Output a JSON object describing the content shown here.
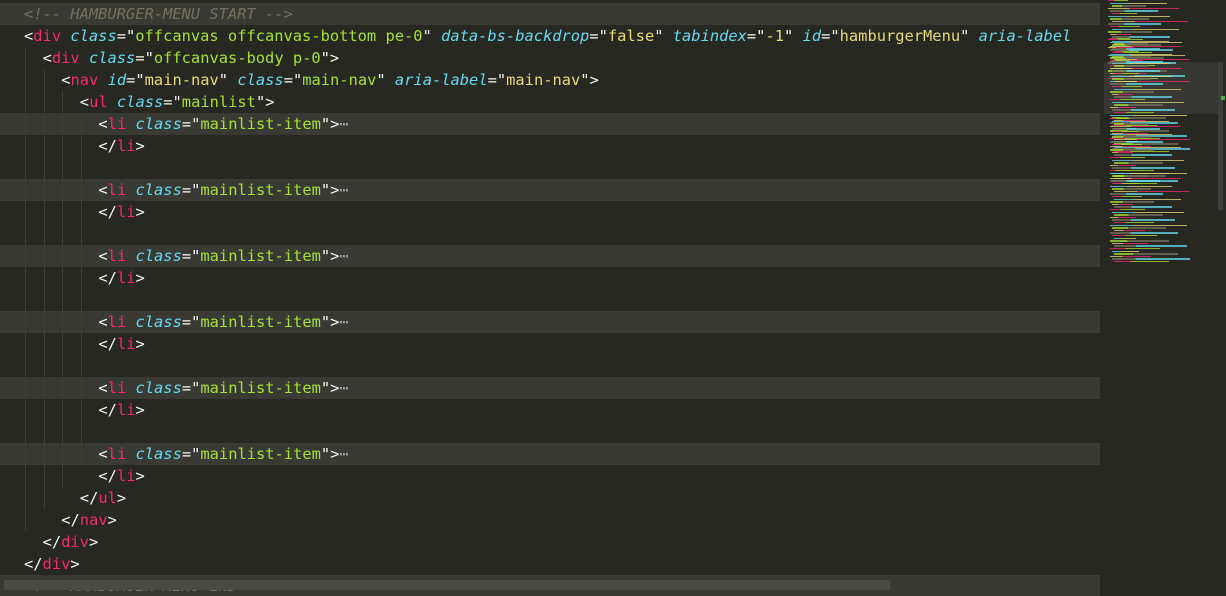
{
  "editor": {
    "lines": [
      {
        "indent": 0,
        "highlight": true,
        "tokens": [
          {
            "t": "cm",
            "v": "<!-- HAMBURGER-MENU START -->"
          }
        ]
      },
      {
        "indent": 0,
        "highlight": false,
        "tokens": [
          {
            "t": "punc",
            "v": "<"
          },
          {
            "t": "tag",
            "v": "div"
          },
          {
            "t": "punc",
            "v": " "
          },
          {
            "t": "attr",
            "v": "class"
          },
          {
            "t": "punc",
            "v": "=\""
          },
          {
            "t": "val",
            "v": "offcanvas offcanvas-bottom pe-0"
          },
          {
            "t": "punc",
            "v": "\" "
          },
          {
            "t": "attr",
            "v": "data-bs-backdrop"
          },
          {
            "t": "punc",
            "v": "=\""
          },
          {
            "t": "str",
            "v": "false"
          },
          {
            "t": "punc",
            "v": "\" "
          },
          {
            "t": "attr",
            "v": "tabindex"
          },
          {
            "t": "punc",
            "v": "=\""
          },
          {
            "t": "str",
            "v": "-1"
          },
          {
            "t": "punc",
            "v": "\" "
          },
          {
            "t": "attr",
            "v": "id"
          },
          {
            "t": "punc",
            "v": "=\""
          },
          {
            "t": "str",
            "v": "hamburgerMenu"
          },
          {
            "t": "punc",
            "v": "\" "
          },
          {
            "t": "attr",
            "v": "aria-label"
          }
        ]
      },
      {
        "indent": 1,
        "highlight": false,
        "tokens": [
          {
            "t": "punc",
            "v": "<"
          },
          {
            "t": "tag",
            "v": "div"
          },
          {
            "t": "punc",
            "v": " "
          },
          {
            "t": "attr",
            "v": "class"
          },
          {
            "t": "punc",
            "v": "=\""
          },
          {
            "t": "val",
            "v": "offcanvas-body p-0"
          },
          {
            "t": "punc",
            "v": "\">"
          }
        ]
      },
      {
        "indent": 2,
        "highlight": false,
        "tokens": [
          {
            "t": "punc",
            "v": "<"
          },
          {
            "t": "tag",
            "v": "nav"
          },
          {
            "t": "punc",
            "v": " "
          },
          {
            "t": "attr",
            "v": "id"
          },
          {
            "t": "punc",
            "v": "=\""
          },
          {
            "t": "str",
            "v": "main-nav"
          },
          {
            "t": "punc",
            "v": "\" "
          },
          {
            "t": "attr",
            "v": "class"
          },
          {
            "t": "punc",
            "v": "=\""
          },
          {
            "t": "val",
            "v": "main-nav"
          },
          {
            "t": "punc",
            "v": "\" "
          },
          {
            "t": "attr",
            "v": "aria-label"
          },
          {
            "t": "punc",
            "v": "=\""
          },
          {
            "t": "str",
            "v": "main-nav"
          },
          {
            "t": "punc",
            "v": "\">"
          }
        ]
      },
      {
        "indent": 3,
        "highlight": false,
        "tokens": [
          {
            "t": "punc",
            "v": "<"
          },
          {
            "t": "tag",
            "v": "ul"
          },
          {
            "t": "punc",
            "v": " "
          },
          {
            "t": "attr",
            "v": "class"
          },
          {
            "t": "punc",
            "v": "=\""
          },
          {
            "t": "val",
            "v": "mainlist"
          },
          {
            "t": "punc",
            "v": "\">"
          }
        ]
      },
      {
        "indent": 4,
        "highlight": true,
        "tokens": [
          {
            "t": "punc",
            "v": "<"
          },
          {
            "t": "tag",
            "v": "li"
          },
          {
            "t": "punc",
            "v": " "
          },
          {
            "t": "attr",
            "v": "class"
          },
          {
            "t": "punc",
            "v": "=\""
          },
          {
            "t": "val",
            "v": "mainlist-item"
          },
          {
            "t": "punc",
            "v": "\">"
          },
          {
            "t": "ell",
            "v": "⋯"
          }
        ]
      },
      {
        "indent": 4,
        "highlight": false,
        "tokens": [
          {
            "t": "punc",
            "v": "</"
          },
          {
            "t": "tag",
            "v": "li"
          },
          {
            "t": "punc",
            "v": ">"
          }
        ]
      },
      {
        "indent": 4,
        "highlight": false,
        "tokens": []
      },
      {
        "indent": 4,
        "highlight": true,
        "tokens": [
          {
            "t": "punc",
            "v": "<"
          },
          {
            "t": "tag",
            "v": "li"
          },
          {
            "t": "punc",
            "v": " "
          },
          {
            "t": "attr",
            "v": "class"
          },
          {
            "t": "punc",
            "v": "=\""
          },
          {
            "t": "val",
            "v": "mainlist-item"
          },
          {
            "t": "punc",
            "v": "\">"
          },
          {
            "t": "ell",
            "v": "⋯"
          }
        ]
      },
      {
        "indent": 4,
        "highlight": false,
        "tokens": [
          {
            "t": "punc",
            "v": "</"
          },
          {
            "t": "tag",
            "v": "li"
          },
          {
            "t": "punc",
            "v": ">"
          }
        ]
      },
      {
        "indent": 4,
        "highlight": false,
        "tokens": []
      },
      {
        "indent": 4,
        "highlight": true,
        "tokens": [
          {
            "t": "punc",
            "v": "<"
          },
          {
            "t": "tag",
            "v": "li"
          },
          {
            "t": "punc",
            "v": " "
          },
          {
            "t": "attr",
            "v": "class"
          },
          {
            "t": "punc",
            "v": "=\""
          },
          {
            "t": "val",
            "v": "mainlist-item"
          },
          {
            "t": "punc",
            "v": "\">"
          },
          {
            "t": "ell",
            "v": "⋯"
          }
        ]
      },
      {
        "indent": 4,
        "highlight": false,
        "tokens": [
          {
            "t": "punc",
            "v": "</"
          },
          {
            "t": "tag",
            "v": "li"
          },
          {
            "t": "punc",
            "v": ">"
          }
        ]
      },
      {
        "indent": 4,
        "highlight": false,
        "tokens": []
      },
      {
        "indent": 4,
        "highlight": true,
        "tokens": [
          {
            "t": "punc",
            "v": "<"
          },
          {
            "t": "tag",
            "v": "li"
          },
          {
            "t": "punc",
            "v": " "
          },
          {
            "t": "attr",
            "v": "class"
          },
          {
            "t": "punc",
            "v": "=\""
          },
          {
            "t": "val",
            "v": "mainlist-item"
          },
          {
            "t": "punc",
            "v": "\">"
          },
          {
            "t": "ell",
            "v": "⋯"
          }
        ]
      },
      {
        "indent": 4,
        "highlight": false,
        "tokens": [
          {
            "t": "punc",
            "v": "</"
          },
          {
            "t": "tag",
            "v": "li"
          },
          {
            "t": "punc",
            "v": ">"
          }
        ]
      },
      {
        "indent": 4,
        "highlight": false,
        "tokens": []
      },
      {
        "indent": 4,
        "highlight": true,
        "tokens": [
          {
            "t": "punc",
            "v": "<"
          },
          {
            "t": "tag",
            "v": "li"
          },
          {
            "t": "punc",
            "v": " "
          },
          {
            "t": "attr",
            "v": "class"
          },
          {
            "t": "punc",
            "v": "=\""
          },
          {
            "t": "val",
            "v": "mainlist-item"
          },
          {
            "t": "punc",
            "v": "\">"
          },
          {
            "t": "ell",
            "v": "⋯"
          }
        ]
      },
      {
        "indent": 4,
        "highlight": false,
        "tokens": [
          {
            "t": "punc",
            "v": "</"
          },
          {
            "t": "tag",
            "v": "li"
          },
          {
            "t": "punc",
            "v": ">"
          }
        ]
      },
      {
        "indent": 4,
        "highlight": false,
        "tokens": []
      },
      {
        "indent": 4,
        "highlight": true,
        "tokens": [
          {
            "t": "punc",
            "v": "<"
          },
          {
            "t": "tag",
            "v": "li"
          },
          {
            "t": "punc",
            "v": " "
          },
          {
            "t": "attr",
            "v": "class"
          },
          {
            "t": "punc",
            "v": "=\""
          },
          {
            "t": "val",
            "v": "mainlist-item"
          },
          {
            "t": "punc",
            "v": "\">"
          },
          {
            "t": "ell",
            "v": "⋯"
          }
        ]
      },
      {
        "indent": 4,
        "highlight": false,
        "tokens": [
          {
            "t": "punc",
            "v": "</"
          },
          {
            "t": "tag",
            "v": "li"
          },
          {
            "t": "punc",
            "v": ">"
          }
        ]
      },
      {
        "indent": 3,
        "highlight": false,
        "tokens": [
          {
            "t": "punc",
            "v": "</"
          },
          {
            "t": "tag",
            "v": "ul"
          },
          {
            "t": "punc",
            "v": ">"
          }
        ]
      },
      {
        "indent": 2,
        "highlight": false,
        "tokens": [
          {
            "t": "punc",
            "v": "</"
          },
          {
            "t": "tag",
            "v": "nav"
          },
          {
            "t": "punc",
            "v": ">"
          }
        ]
      },
      {
        "indent": 1,
        "highlight": false,
        "tokens": [
          {
            "t": "punc",
            "v": "</"
          },
          {
            "t": "tag",
            "v": "div"
          },
          {
            "t": "punc",
            "v": ">"
          }
        ]
      },
      {
        "indent": 0,
        "highlight": false,
        "tokens": [
          {
            "t": "punc",
            "v": "</"
          },
          {
            "t": "tag",
            "v": "div"
          },
          {
            "t": "punc",
            "v": ">"
          }
        ]
      },
      {
        "indent": 0,
        "highlight": true,
        "tokens": [
          {
            "t": "cm",
            "v": "<!-- HAMBURGER-MENU END -->"
          }
        ]
      }
    ]
  },
  "colors": {
    "background": "#272822",
    "comment": "#75715e",
    "tag": "#f92672",
    "attribute": "#66d9ef",
    "string": "#e6db74",
    "value": "#a6e22e",
    "minimap_marker": "#4caf50"
  }
}
